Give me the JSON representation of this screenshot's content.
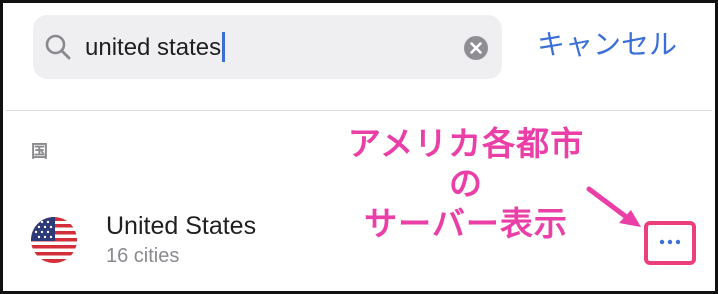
{
  "search": {
    "value": "united states"
  },
  "header": {
    "cancel_label": "キャンセル"
  },
  "section": {
    "label": "国"
  },
  "annotation": {
    "line1": "アメリカ各都市の",
    "line2": "サーバー表示"
  },
  "results": [
    {
      "name": "United States",
      "subtitle": "16 cities",
      "flag_icon": "us-flag-icon"
    }
  ],
  "colors": {
    "accent": "#3b6fd8",
    "annotation": "#ea3fa7",
    "highlight_border": "#ea3f7c",
    "search_bg": "#efeff2",
    "secondary_text": "#8a8a8e"
  }
}
